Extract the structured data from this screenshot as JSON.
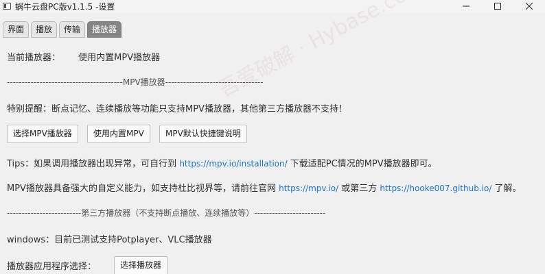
{
  "window": {
    "title": "蜗牛云盘PC版v1.1.5 -设置",
    "controls": [
      "minimize",
      "maximize",
      "close"
    ]
  },
  "tabs": [
    {
      "label": "界面",
      "active": false
    },
    {
      "label": "播放",
      "active": false
    },
    {
      "label": "传输",
      "active": false
    },
    {
      "label": "播放器",
      "active": true
    }
  ],
  "content": {
    "current_player_label": "当前播放器：",
    "current_player_value": "使用内置MPV播放器",
    "mpv_divider": "---------------------------------------MPV播放器---------------------------------",
    "note": "特别提醒：断点记忆、连续播放等功能只支持MPV播放器，其他第三方播放器不支持！",
    "buttons": {
      "select_mpv": "选择MPV播放器",
      "use_builtin": "使用内置MPV",
      "mpv_shortcuts": "MPV默认快捷键说明"
    },
    "tips": {
      "prefix": "Tips：如果调用播放器出现异常，可自行到",
      "link": "https://mpv.io/installation/",
      "suffix": "下载适配PC情况的MPV播放器即可。"
    },
    "mpv_info": {
      "prefix": "MPV播放器具备强大的自定义能力，如支持杜比视界等，请前往官网",
      "link1": "https://mpv.io/",
      "middle": "或第三方",
      "link2": "https://hooke007.github.io/",
      "suffix": "了解。"
    },
    "third_party_divider": "-------------------------第三方播放器（不支持断点播放、连续播放等）------------------------",
    "windows_note": "windows：目前已测试支持Potplayer、VLC播放器",
    "app_select_label": "播放器应用程序选择：",
    "select_player_button": "选择播放器"
  },
  "watermark": "吾爱破解 · Hybase.com"
}
